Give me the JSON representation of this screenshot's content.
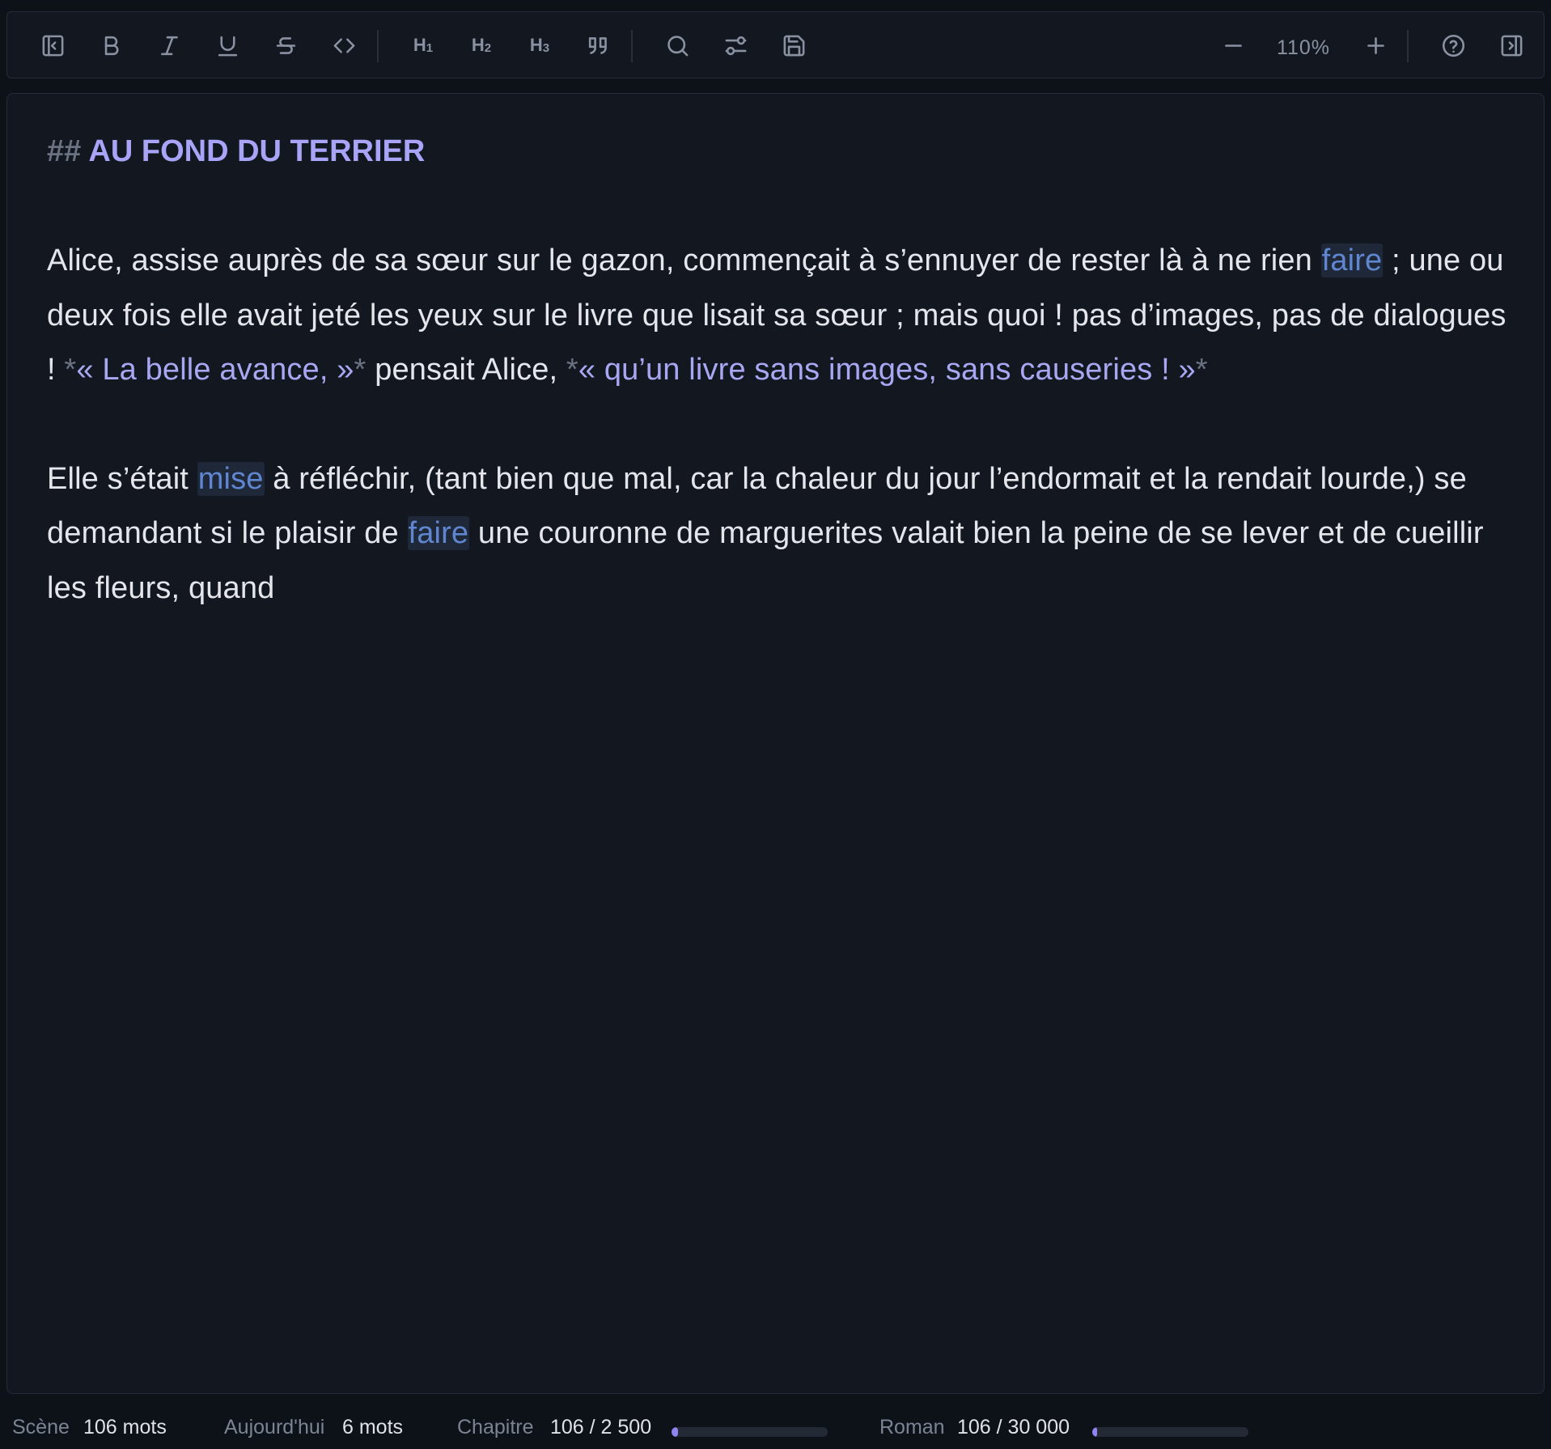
{
  "toolbar": {
    "zoom": "110%",
    "h1": "H",
    "h2": "H",
    "h3": "H",
    "h1_sub": "1",
    "h2_sub": "2",
    "h3_sub": "3",
    "icons": [
      "sidebar-left-icon",
      "bold-icon",
      "italic-icon",
      "underline-icon",
      "strikethrough-icon",
      "code-icon",
      "heading-1-icon",
      "heading-2-icon",
      "heading-3-icon",
      "quote-icon",
      "search-icon",
      "settings-sliders-icon",
      "save-icon",
      "zoom-out-icon",
      "zoom-in-icon",
      "help-icon",
      "sidebar-right-icon"
    ]
  },
  "editor": {
    "heading_mark": "##",
    "heading_text": " AU FOND DU TERRIER",
    "p1": {
      "t1": "Alice, assise auprès de sa sœur sur le gazon, commençait à s’ennuyer de rester là à ne rien ",
      "hl1": "faire",
      "t2": " ; une ou deux fois elle avait jeté les yeux sur le livre que lisait sa sœur ; mais quoi ! pas d’images, pas de dialogues ! ",
      "em1_open": "*",
      "em1_text": "« La belle avance, »",
      "em1_close": "*",
      "t3": " pensait Alice, ",
      "em2_open": "*",
      "em2_text": "« qu’un livre sans images, sans causeries ! »",
      "em2_close": "*"
    },
    "p2": {
      "t1": "Elle s’était ",
      "hl1": "mise",
      "t2": " à réfléchir, (tant bien que mal, car la chaleur du jour l’endormait et la rendait lourde,) se demandant si le plaisir de ",
      "hl2": "faire",
      "t3": " une couronne de marguerites valait bien la peine de se lever et de cueillir les fleurs, quand"
    }
  },
  "status": {
    "scene_label": "Scène",
    "scene_value": "106 mots",
    "today_label": "Aujourd'hui",
    "today_value": "6 mots",
    "chapter_label": "Chapitre",
    "chapter_value": "106 / 2 500",
    "chapter_progress": 0.0424,
    "novel_label": "Roman",
    "novel_value": "106 / 30 000",
    "novel_progress": 0.0035
  },
  "colors": {
    "accent": "#a9a4f7",
    "highlight_text": "#5f86cf",
    "background": "#121720"
  }
}
